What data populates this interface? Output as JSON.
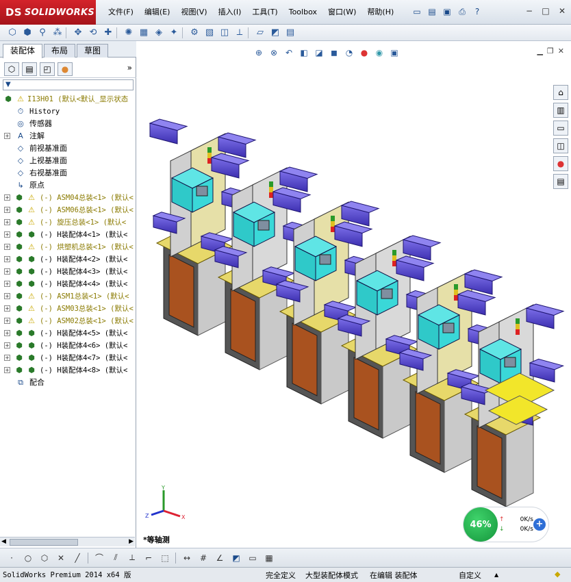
{
  "app": {
    "logo_ds": "DS",
    "logo_text": "SOLIDWORKS",
    "menu": [
      "文件(F)",
      "编辑(E)",
      "视图(V)",
      "插入(I)",
      "工具(T)",
      "Toolbox",
      "窗口(W)",
      "帮助(H)"
    ],
    "help_icon": "?"
  },
  "feature_manager": {
    "tabs": [
      "装配体",
      "布局",
      "草图"
    ],
    "active_tab": 0,
    "more_label": "»",
    "filter_label": "▼",
    "root": "I13H01  (默认<默认_显示状态",
    "items": [
      {
        "text": "History",
        "mono": true,
        "icon": "history-icon",
        "glyph": "⏱",
        "expand": ""
      },
      {
        "text": "传感器",
        "icon": "sensor-icon",
        "glyph": "◎",
        "expand": ""
      },
      {
        "text": "注解",
        "icon": "annotation-icon",
        "glyph": "A",
        "expand": "+"
      },
      {
        "text": "前视基准面",
        "icon": "plane-icon",
        "glyph": "◇",
        "expand": ""
      },
      {
        "text": "上视基准面",
        "icon": "plane-icon",
        "glyph": "◇",
        "expand": ""
      },
      {
        "text": "右视基准面",
        "icon": "plane-icon",
        "glyph": "◇",
        "expand": ""
      },
      {
        "text": "原点",
        "icon": "origin-icon",
        "glyph": "↳",
        "expand": ""
      },
      {
        "text": "(-) ASM04总装<1> (默认<",
        "warn": true,
        "yellow": true,
        "expand": "+"
      },
      {
        "text": "(-) ASM06总装<1> (默认<",
        "warn": true,
        "yellow": true,
        "expand": "+"
      },
      {
        "text": "(-) 旋压总装<1> (默认<",
        "warn": true,
        "yellow": true,
        "expand": "+"
      },
      {
        "text": "(-) H装配体4<1> (默认<",
        "warn": false,
        "yellow": false,
        "expand": "+"
      },
      {
        "text": "(-) 烘塑机总装<1> (默认<",
        "warn": true,
        "yellow": true,
        "expand": "+"
      },
      {
        "text": "(-) H装配体4<2> (默认<",
        "warn": false,
        "yellow": false,
        "expand": "+"
      },
      {
        "text": "(-) H装配体4<3> (默认<",
        "warn": false,
        "yellow": false,
        "expand": "+"
      },
      {
        "text": "(-) H装配体4<4> (默认<",
        "warn": false,
        "yellow": false,
        "expand": "+"
      },
      {
        "text": "(-) ASM1总装<1> (默认<",
        "warn": true,
        "yellow": true,
        "expand": "+"
      },
      {
        "text": "(-) ASM03总装<1> (默认<",
        "warn": true,
        "yellow": true,
        "expand": "+"
      },
      {
        "text": "(-) ASM02总装<1> (默认<",
        "warn": true,
        "yellow": true,
        "expand": "+"
      },
      {
        "text": "(-) H装配体4<5> (默认<",
        "warn": false,
        "yellow": false,
        "expand": "+"
      },
      {
        "text": "(-) H装配体4<6> (默认<",
        "warn": false,
        "yellow": false,
        "expand": "+"
      },
      {
        "text": "(-) H装配体4<7> (默认<",
        "warn": false,
        "yellow": false,
        "expand": "+"
      },
      {
        "text": "(-) H装配体4<8> (默认<",
        "warn": false,
        "yellow": false,
        "expand": "+"
      },
      {
        "text": "配合",
        "icon": "mates-icon",
        "glyph": "⧉",
        "expand": ""
      }
    ]
  },
  "viewport": {
    "view_label": "*等轴测",
    "triad": {
      "x": "X",
      "y": "Y",
      "z": "Z"
    }
  },
  "net_widget": {
    "percent": "46%",
    "up": "0K/s",
    "down": "0K/s",
    "plus": "+"
  },
  "status": {
    "app_name": "SolidWorks Premium 2014 x64 版",
    "cells": [
      "完全定义",
      "大型装配体模式",
      "在编辑 装配体",
      "自定义"
    ],
    "caret": "▲"
  }
}
